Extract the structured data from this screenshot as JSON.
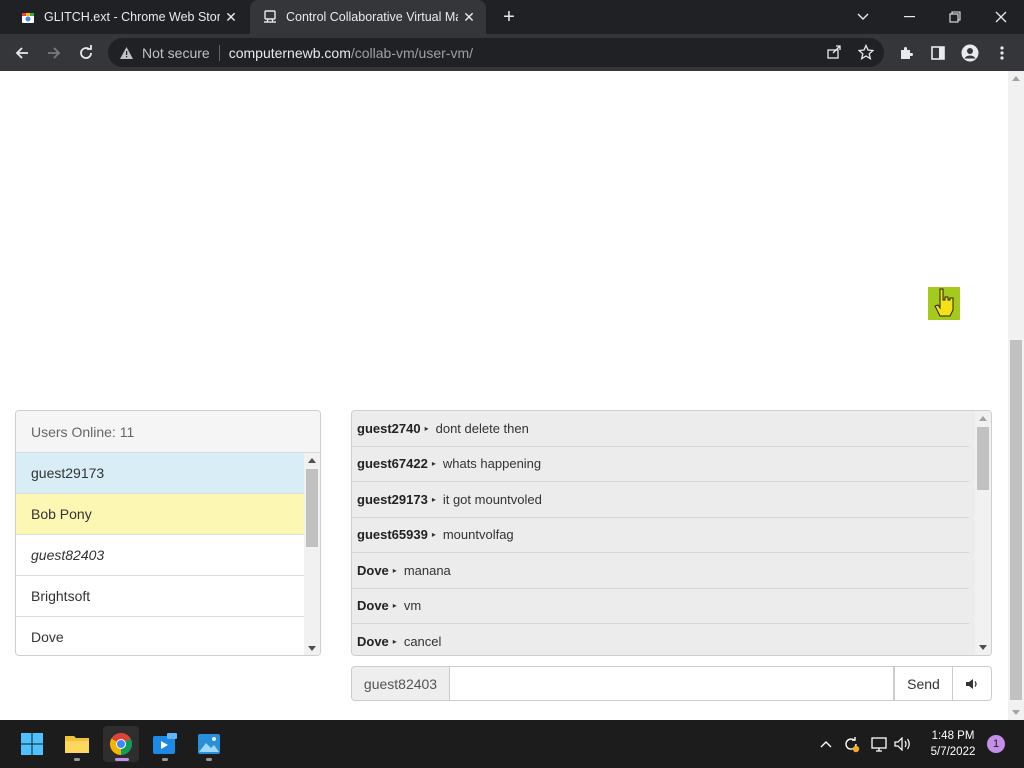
{
  "browser": {
    "tabs": [
      {
        "title": "GLITCH.ext - Chrome Web Store",
        "active": false
      },
      {
        "title": "Control Collaborative Virtual Mac",
        "active": true
      }
    ],
    "security_label": "Not secure",
    "url_host": "computernewb.com",
    "url_path": "/collab-vm/user-vm/"
  },
  "users": {
    "header": "Users Online: 11",
    "items": [
      {
        "name": "guest29173",
        "style": "blue"
      },
      {
        "name": "Bob Pony",
        "style": "yellow"
      },
      {
        "name": "guest82403",
        "style": "italic"
      },
      {
        "name": "Brightsoft",
        "style": "plain"
      },
      {
        "name": "Dove",
        "style": "plain"
      }
    ]
  },
  "chat": {
    "messages": [
      {
        "user": "guest2740",
        "text": "dont delete then"
      },
      {
        "user": "guest67422",
        "text": "whats happening"
      },
      {
        "user": "guest29173",
        "text": "it got mountvoled"
      },
      {
        "user": "guest65939",
        "text": "mountvolfag"
      },
      {
        "user": "Dove",
        "text": "manana"
      },
      {
        "user": "Dove",
        "text": "vm"
      },
      {
        "user": "Dove",
        "text": "cancel"
      }
    ],
    "username": "guest82403",
    "input_value": "",
    "send_label": "Send"
  },
  "taskbar": {
    "time": "1:48 PM",
    "date": "5/7/2022",
    "notification_count": "1"
  },
  "colors": {
    "accent_purple": "#c38fe8",
    "user_highlight_blue": "#d9edf7",
    "user_highlight_yellow": "#fcf8b3",
    "cursor_green": "#a6c91d"
  }
}
